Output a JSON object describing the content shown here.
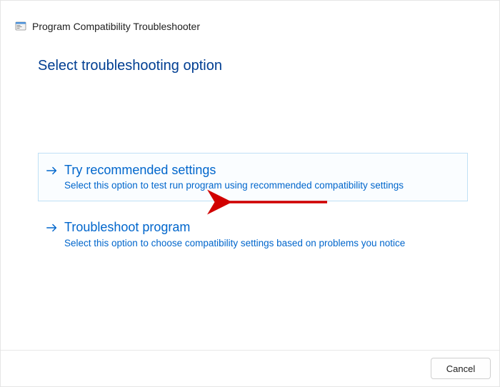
{
  "window": {
    "title": "Program Compatibility Troubleshooter"
  },
  "page": {
    "heading": "Select troubleshooting option"
  },
  "options": {
    "recommended": {
      "title": "Try recommended settings",
      "desc": "Select this option to test run program using recommended compatibility settings"
    },
    "troubleshoot": {
      "title": "Troubleshoot program",
      "desc": "Select this option to choose compatibility settings based on problems you notice"
    }
  },
  "footer": {
    "cancel": "Cancel"
  }
}
